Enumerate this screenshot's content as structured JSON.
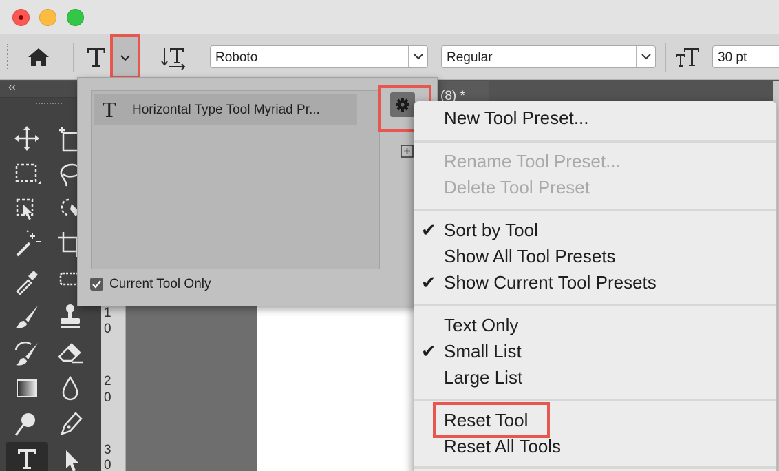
{
  "window": {
    "title": ""
  },
  "options_bar": {
    "font_family": "Roboto",
    "font_style": "Regular",
    "font_size": "30 pt"
  },
  "collapse_icon": "‹‹",
  "document_tab": {
    "label": "(8) *"
  },
  "ruler": {
    "marks": [
      "1",
      "0",
      "2",
      "0",
      "3",
      "0"
    ]
  },
  "preset_panel": {
    "items": [
      {
        "icon": "T",
        "label": "Horizontal Type Tool Myriad Pr..."
      }
    ],
    "current_tool_only_label": "Current Tool Only",
    "current_tool_only_checked": true
  },
  "menu": {
    "new_preset": "New Tool Preset...",
    "rename_preset": "Rename Tool Preset...",
    "delete_preset": "Delete Tool Preset",
    "sort_by_tool": "Sort by Tool",
    "show_all": "Show All Tool Presets",
    "show_current": "Show Current Tool Presets",
    "text_only": "Text Only",
    "small_list": "Small List",
    "large_list": "Large List",
    "reset_tool": "Reset Tool",
    "reset_all": "Reset All Tools",
    "check_glyph": "✔"
  },
  "colors": {
    "highlight": "#e8574f",
    "menu_bg": "#ececec",
    "disabled_text": "#a9a9a9"
  }
}
